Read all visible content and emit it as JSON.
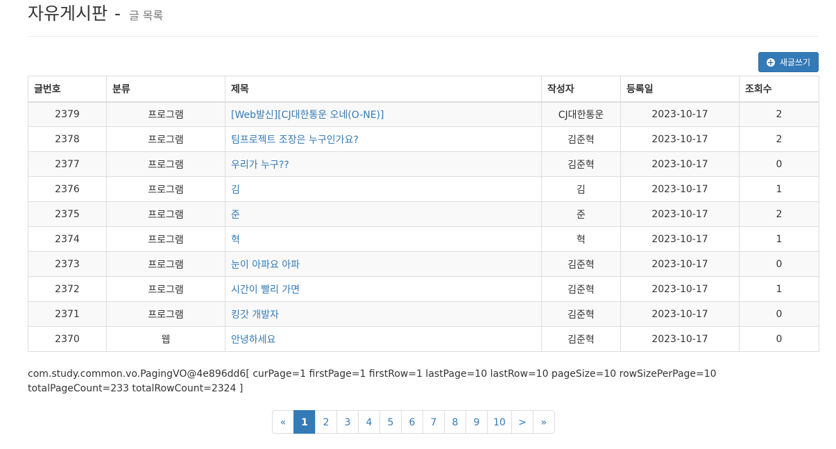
{
  "header": {
    "title": "자유게시판",
    "separator": "-",
    "subtitle": "글 목록"
  },
  "toolbar": {
    "new_post_label": "새글쓰기",
    "new_post_icon": "plus-circle-icon"
  },
  "table": {
    "columns": [
      "글번호",
      "분류",
      "제목",
      "작성자",
      "등록일",
      "조회수"
    ],
    "rows": [
      {
        "no": "2379",
        "category": "프로그램",
        "title": "[Web발신][CJ대한통운 오네(O-NE)]",
        "author": "CJ대한통운",
        "date": "2023-10-17",
        "views": "2"
      },
      {
        "no": "2378",
        "category": "프로그램",
        "title": "팀프로젝트 조장은 누구인가요?",
        "author": "김준혁",
        "date": "2023-10-17",
        "views": "2"
      },
      {
        "no": "2377",
        "category": "프로그램",
        "title": "우리가 누구??",
        "author": "김준혁",
        "date": "2023-10-17",
        "views": "0"
      },
      {
        "no": "2376",
        "category": "프로그램",
        "title": "김",
        "author": "김",
        "date": "2023-10-17",
        "views": "1"
      },
      {
        "no": "2375",
        "category": "프로그램",
        "title": "준",
        "author": "준",
        "date": "2023-10-17",
        "views": "2"
      },
      {
        "no": "2374",
        "category": "프로그램",
        "title": "혁",
        "author": "혁",
        "date": "2023-10-17",
        "views": "1"
      },
      {
        "no": "2373",
        "category": "프로그램",
        "title": "눈이 아파요 아파",
        "author": "김준혁",
        "date": "2023-10-17",
        "views": "0"
      },
      {
        "no": "2372",
        "category": "프로그램",
        "title": "시간이 빨리 가면",
        "author": "김준혁",
        "date": "2023-10-17",
        "views": "1"
      },
      {
        "no": "2371",
        "category": "프로그램",
        "title": "킹갓 개발자",
        "author": "김준혁",
        "date": "2023-10-17",
        "views": "0"
      },
      {
        "no": "2370",
        "category": "웹",
        "title": "안녕하세요",
        "author": "김준혁",
        "date": "2023-10-17",
        "views": "0"
      }
    ]
  },
  "paging_info": "com.study.common.vo.PagingVO@4e896dd6[ curPage=1 firstPage=1 firstRow=1 lastPage=10 lastRow=10 pageSize=10 rowSizePerPage=10 totalPageCount=233 totalRowCount=2324 ]",
  "pagination": {
    "first": "«",
    "pages": [
      "1",
      "2",
      "3",
      "4",
      "5",
      "6",
      "7",
      "8",
      "9",
      "10"
    ],
    "active": "1",
    "next": ">",
    "last": "»"
  },
  "colors": {
    "primary": "#337ab7",
    "link": "#337ab7",
    "stripe": "#f9f9f9",
    "border": "#dddddd"
  }
}
